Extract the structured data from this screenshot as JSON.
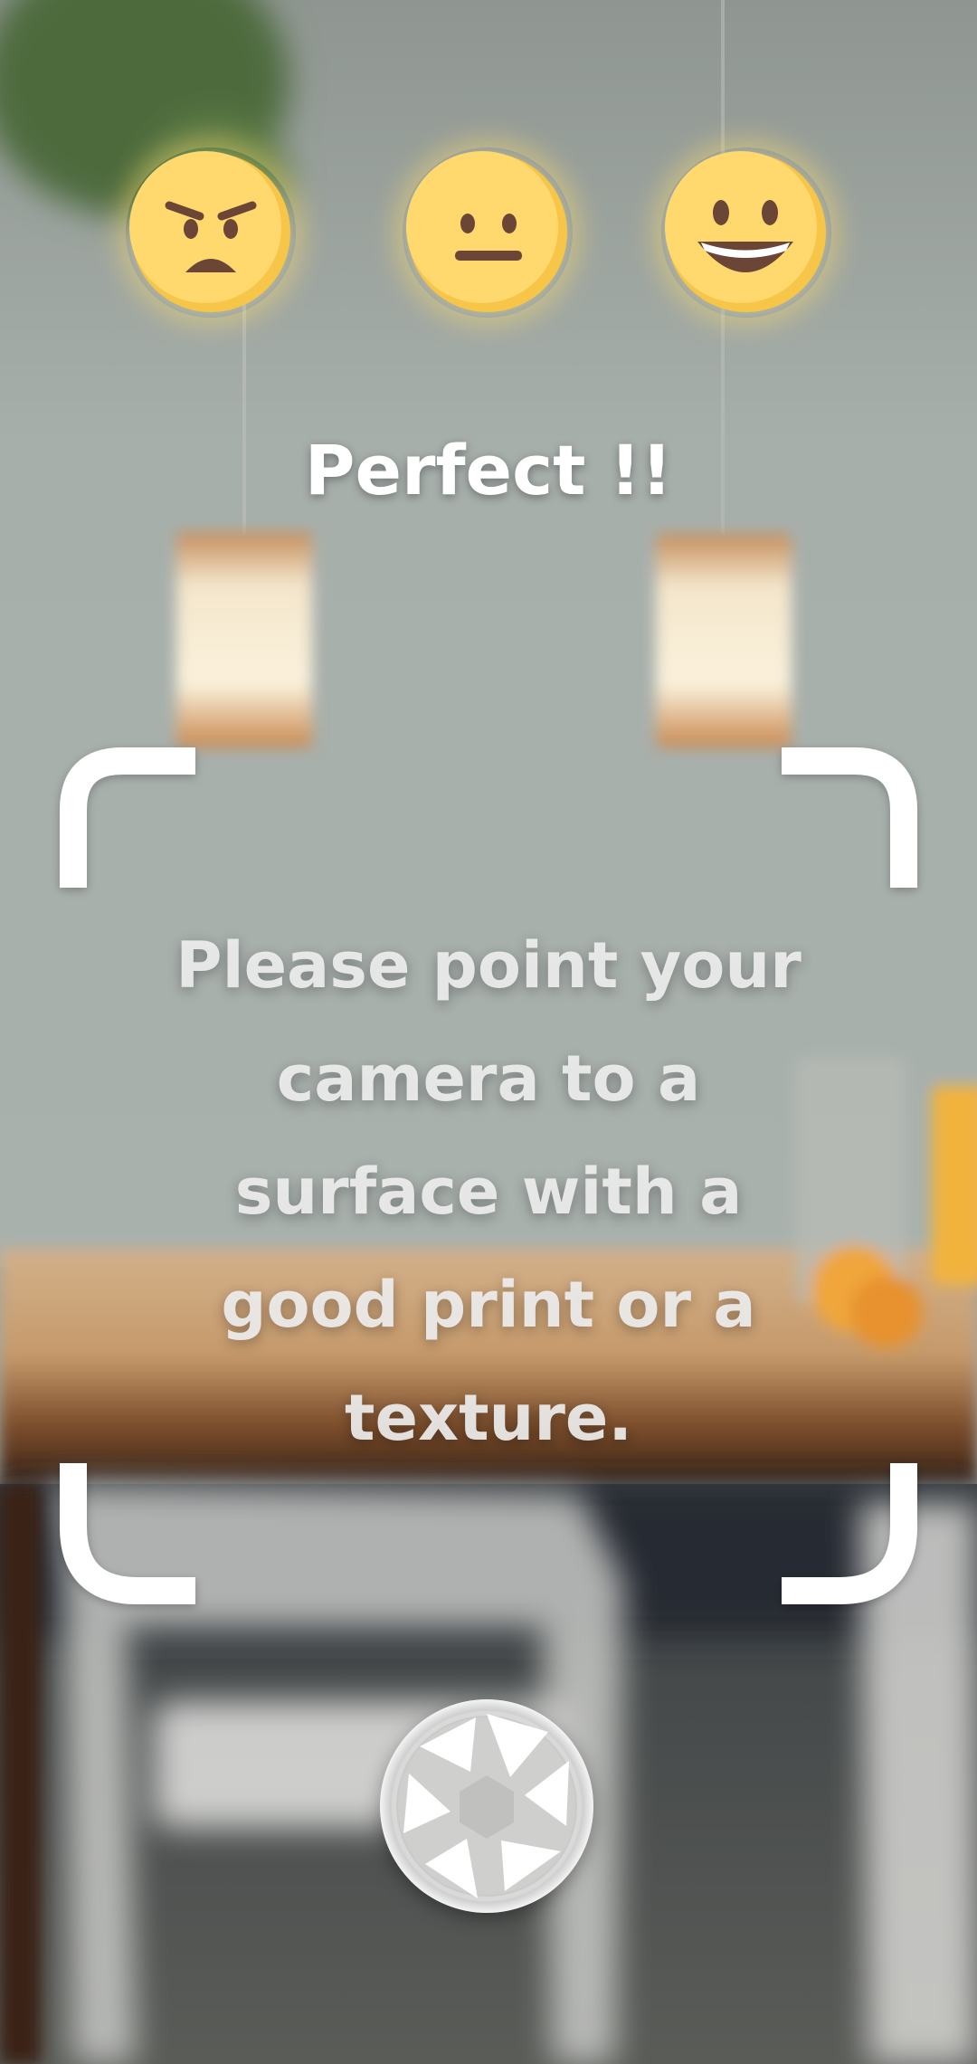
{
  "screen": {
    "status_text": "Perfect !!",
    "instruction_text": "Please point your camera to a surface with a good print or a texture."
  },
  "rating": {
    "faces": [
      {
        "name": "angry-face-icon",
        "label": "angry"
      },
      {
        "name": "neutral-face-icon",
        "label": "neutral"
      },
      {
        "name": "smiling-face-icon",
        "label": "happy"
      }
    ]
  },
  "icons": {
    "shutter": "camera-shutter-icon",
    "frame": "scan-frame-corners"
  },
  "colors": {
    "emoji_yellow": "#FFD96E",
    "emoji_shade": "#F7C649",
    "emoji_features": "#6B4536",
    "text_white": "#FFFFFF",
    "frame_white": "#FFFFFF"
  }
}
